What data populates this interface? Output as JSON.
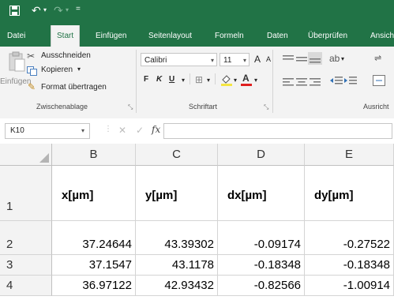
{
  "quick_access": {
    "save_icon": "save-icon",
    "undo_icon": "undo-icon",
    "redo_icon": "redo-icon",
    "customize_icon": "customize-quick-access-icon"
  },
  "tabs": [
    "Datei",
    "Start",
    "Einfügen",
    "Seitenlayout",
    "Formeln",
    "Daten",
    "Überprüfen",
    "Ansicht"
  ],
  "active_tab": "Start",
  "ribbon": {
    "clipboard": {
      "paste": "Einfügen",
      "cut": "Ausschneiden",
      "copy": "Kopieren",
      "copy_arrow": "▾",
      "format_painter": "Format übertragen",
      "group_label": "Zwischenablage"
    },
    "font": {
      "font_name": "Calibri",
      "font_size": "11",
      "bold": "F",
      "italic": "K",
      "underline": "U",
      "grow": "A",
      "shrink": "A",
      "group_label": "Schriftart"
    },
    "alignment": {
      "group_label": "Ausricht"
    }
  },
  "formula_bar": {
    "name_box": "K10",
    "cancel": "✕",
    "enter": "✓",
    "fx": "fx",
    "value": ""
  },
  "grid": {
    "columns": [
      "B",
      "C",
      "D",
      "E"
    ],
    "rows": [
      {
        "num": "1",
        "cells": [
          "x[µm]",
          "y[µm]",
          "dx[µm]",
          "dy[µm]"
        ]
      },
      {
        "num": "2",
        "cells": [
          "37.24644",
          "43.39302",
          "-0.09174",
          "-0.27522"
        ]
      },
      {
        "num": "3",
        "cells": [
          "37.1547",
          "43.1178",
          "-0.18348",
          "-0.18348"
        ]
      },
      {
        "num": "4",
        "cells": [
          "36.97122",
          "42.93432",
          "-0.82566",
          "-1.00914"
        ]
      }
    ]
  },
  "colors": {
    "accent": "#217346",
    "ribbon": "#f3f3f3",
    "grid_line": "#d4d4d4"
  }
}
